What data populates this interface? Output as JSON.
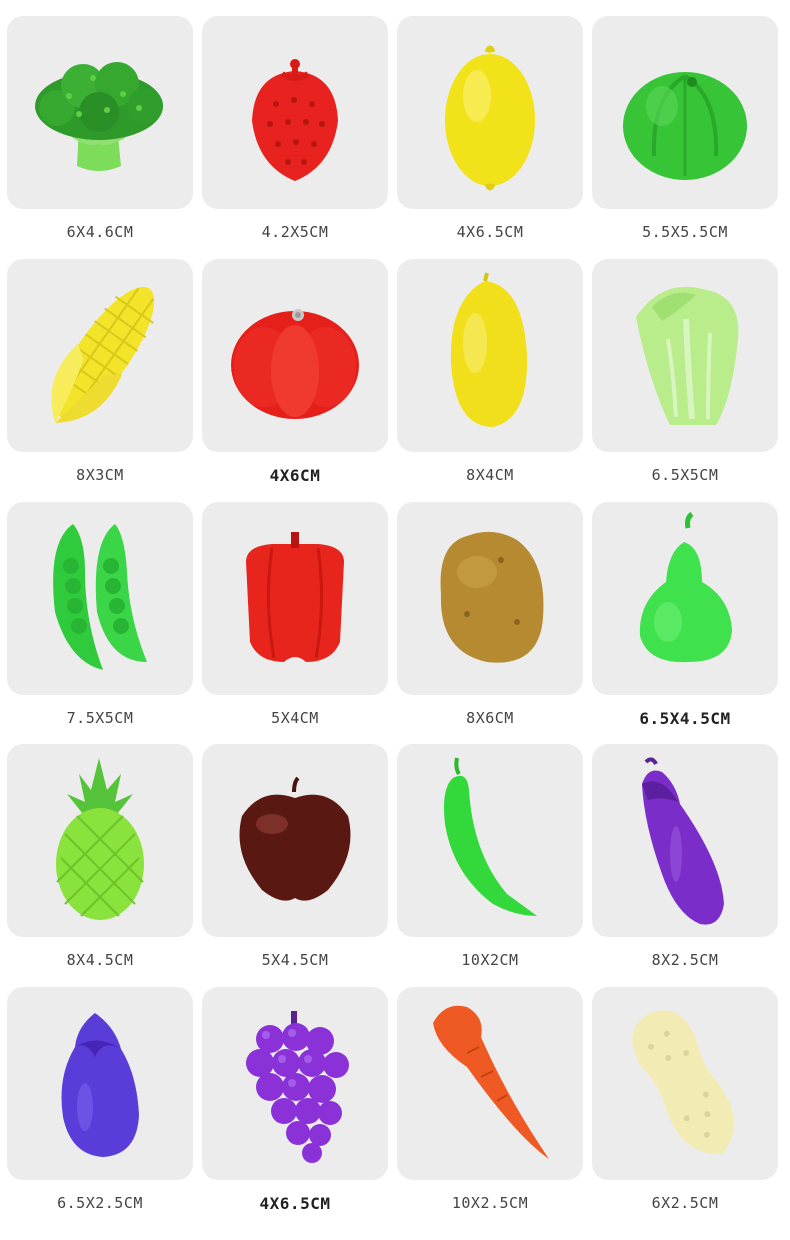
{
  "items": [
    {
      "name": "broccoli",
      "size": "6X4.6CM",
      "bold": false
    },
    {
      "name": "strawberry",
      "size": "4.2X5CM",
      "bold": false
    },
    {
      "name": "lemon",
      "size": "4X6.5CM",
      "bold": false
    },
    {
      "name": "cabbage",
      "size": "5.5X5.5CM",
      "bold": false
    },
    {
      "name": "corn",
      "size": "8X3CM",
      "bold": false
    },
    {
      "name": "tomato",
      "size": "4X6CM",
      "bold": true
    },
    {
      "name": "mango",
      "size": "8X4CM",
      "bold": false
    },
    {
      "name": "chinese-cabbage",
      "size": "6.5X5CM",
      "bold": false
    },
    {
      "name": "pea-pod",
      "size": "7.5X5CM",
      "bold": false
    },
    {
      "name": "bell-pepper",
      "size": "5X4CM",
      "bold": false
    },
    {
      "name": "potato",
      "size": "8X6CM",
      "bold": false
    },
    {
      "name": "pear",
      "size": "6.5X4.5CM",
      "bold": true
    },
    {
      "name": "pineapple",
      "size": "8X4.5CM",
      "bold": false
    },
    {
      "name": "apple",
      "size": "5X4.5CM",
      "bold": false
    },
    {
      "name": "green-chili",
      "size": "10X2CM",
      "bold": false
    },
    {
      "name": "eggplant",
      "size": "8X2.5CM",
      "bold": false
    },
    {
      "name": "small-eggplant",
      "size": "6.5X2.5CM",
      "bold": false
    },
    {
      "name": "grapes",
      "size": "4X6.5CM",
      "bold": true
    },
    {
      "name": "carrot",
      "size": "10X2.5CM",
      "bold": false
    },
    {
      "name": "peanut",
      "size": "6X2.5CM",
      "bold": false
    }
  ]
}
